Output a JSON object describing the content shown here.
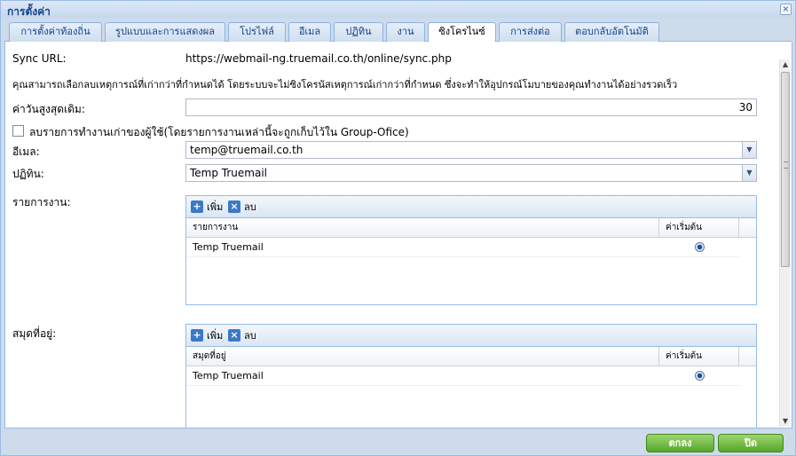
{
  "window": {
    "title": "การตั้งค่า",
    "close_symbol": "×"
  },
  "tabs": [
    {
      "label": "การตั้งค่าท้องถิ่น"
    },
    {
      "label": "รูปแบบและการแสดงผล"
    },
    {
      "label": "โปรไฟล์"
    },
    {
      "label": "อีเมล"
    },
    {
      "label": "ปฏิทิน"
    },
    {
      "label": "งาน"
    },
    {
      "label": "ซิงโครไนซ์"
    },
    {
      "label": "การส่งต่อ"
    },
    {
      "label": "ตอบกลับอัตโนมัติ"
    }
  ],
  "active_tab": "ซิงโครไนซ์",
  "sync": {
    "url_label": "Sync URL:",
    "url_value": "https://webmail-ng.truemail.co.th/online/sync.php",
    "description": "คุณสามารถเลือกลบเหตุการณ์ที่เก่ากว่าที่กำหนดได้ โดยระบบจะไม่ซิงโครนัสเหตุการณ์เก่ากว่าที่กำหนด ซึ่งจะทำให้อุปกรณ์โมบายของคุณทำงานได้อย่างรวดเร็ว",
    "max_days_label": "ค่าวันสูงสุดเดิม:",
    "max_days_value": "30",
    "delete_old_tasks_label": "ลบรายการทำงานเก่าของผู้ใช้(โดยรายการงานเหล่านี้จะถูกเก็บไว้ใน Group-Ofice)",
    "delete_old_tasks_checked": false,
    "email_label": "อีเมล:",
    "email_value": "temp@truemail.co.th",
    "calendar_label": "ปฏิทิน:",
    "calendar_value": "Temp Truemail"
  },
  "tasks": {
    "label": "รายการงาน:",
    "add_label": "เพิ่ม",
    "delete_label": "ลบ",
    "col_name": "รายการงาน",
    "col_default": "ค่าเริ่มต้น",
    "rows": [
      {
        "name": "Temp Truemail",
        "default": true
      }
    ]
  },
  "addressbooks": {
    "label": "สมุดที่อยู่:",
    "add_label": "เพิ่ม",
    "delete_label": "ลบ",
    "col_name": "สมุดที่อยู่",
    "col_default": "ค่าเริ่มต้น",
    "rows": [
      {
        "name": "Temp Truemail",
        "default": true
      }
    ]
  },
  "footer": {
    "ok_label": "ตกลง",
    "close_label": "ปิด"
  },
  "colors": {
    "window_bg": "#cedbea",
    "tab_border": "#8db2e3",
    "button_green": "#55a72a"
  }
}
